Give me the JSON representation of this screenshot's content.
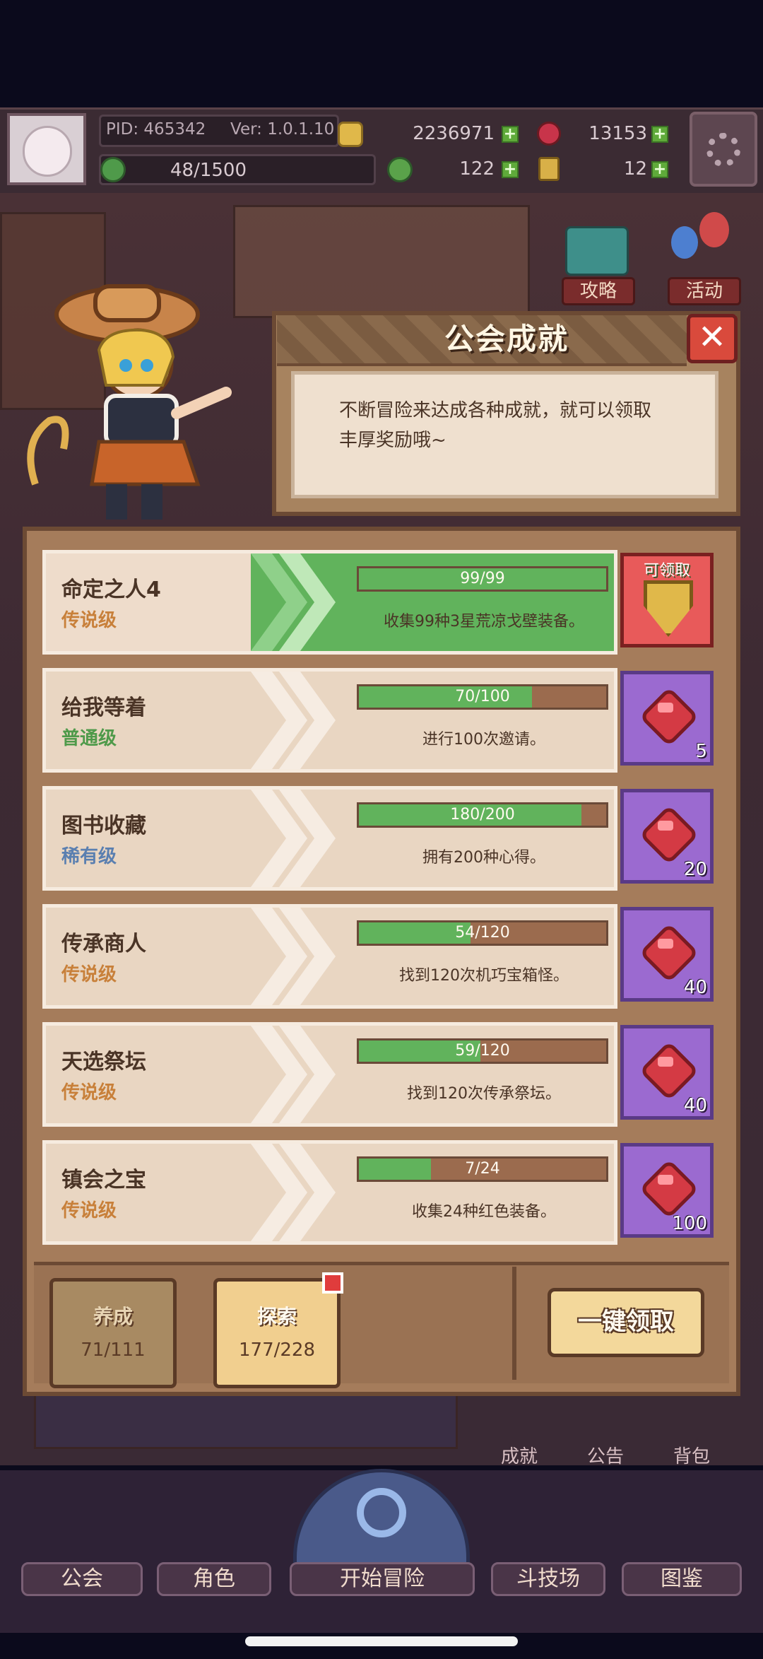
{
  "header": {
    "pid": "PID: 465342",
    "version": "Ver: 1.0.1.10",
    "gold": "2236971",
    "gems": "13153",
    "energy": "48/1500",
    "clover": "122",
    "key": "12"
  },
  "side_buttons": {
    "guide": "攻略",
    "events": "活动"
  },
  "dialog": {
    "title": "公会成就",
    "description_line1": "不断冒险来达成各种成就，就可以领取",
    "description_line2": "丰厚奖励哦~"
  },
  "achievements": [
    {
      "name": "命定之人4",
      "tier": "传说级",
      "progress_text": "99/99",
      "progress": 1.0,
      "desc": "收集99种3星荒凉戈壁装备。",
      "reward_label": "可领取",
      "reward_count": "",
      "claimable": true
    },
    {
      "name": "给我等着",
      "tier": "普通级",
      "progress_text": "70/100",
      "progress": 0.7,
      "desc": "进行100次邀请。",
      "reward_label": "",
      "reward_count": "5",
      "claimable": false
    },
    {
      "name": "图书收藏",
      "tier": "稀有级",
      "progress_text": "180/200",
      "progress": 0.9,
      "desc": "拥有200种心得。",
      "reward_label": "",
      "reward_count": "20",
      "claimable": false
    },
    {
      "name": "传承商人",
      "tier": "传说级",
      "progress_text": "54/120",
      "progress": 0.45,
      "desc": "找到120次机巧宝箱怪。",
      "reward_label": "",
      "reward_count": "40",
      "claimable": false
    },
    {
      "name": "天选祭坛",
      "tier": "传说级",
      "progress_text": "59/120",
      "progress": 0.49,
      "desc": "找到120次传承祭坛。",
      "reward_label": "",
      "reward_count": "40",
      "claimable": false
    },
    {
      "name": "镇会之宝",
      "tier": "传说级",
      "progress_text": "7/24",
      "progress": 0.29,
      "desc": "收集24种红色装备。",
      "reward_label": "",
      "reward_count": "100",
      "claimable": false
    }
  ],
  "tier_colors": {
    "传说级": "#c8803a",
    "普通级": "#4f9a4a",
    "稀有级": "#5a7fb0"
  },
  "tabs": {
    "cultivate_label": "养成",
    "cultivate_count": "71/111",
    "explore_label": "探索",
    "explore_count": "177/228"
  },
  "claim_all": "一键领取",
  "side_icons": {
    "achievement": "成就",
    "notice": "公告",
    "bag": "背包"
  },
  "nav": {
    "guild": "公会",
    "character": "角色",
    "start": "开始冒险",
    "arena": "斗技场",
    "codex": "图鉴"
  }
}
